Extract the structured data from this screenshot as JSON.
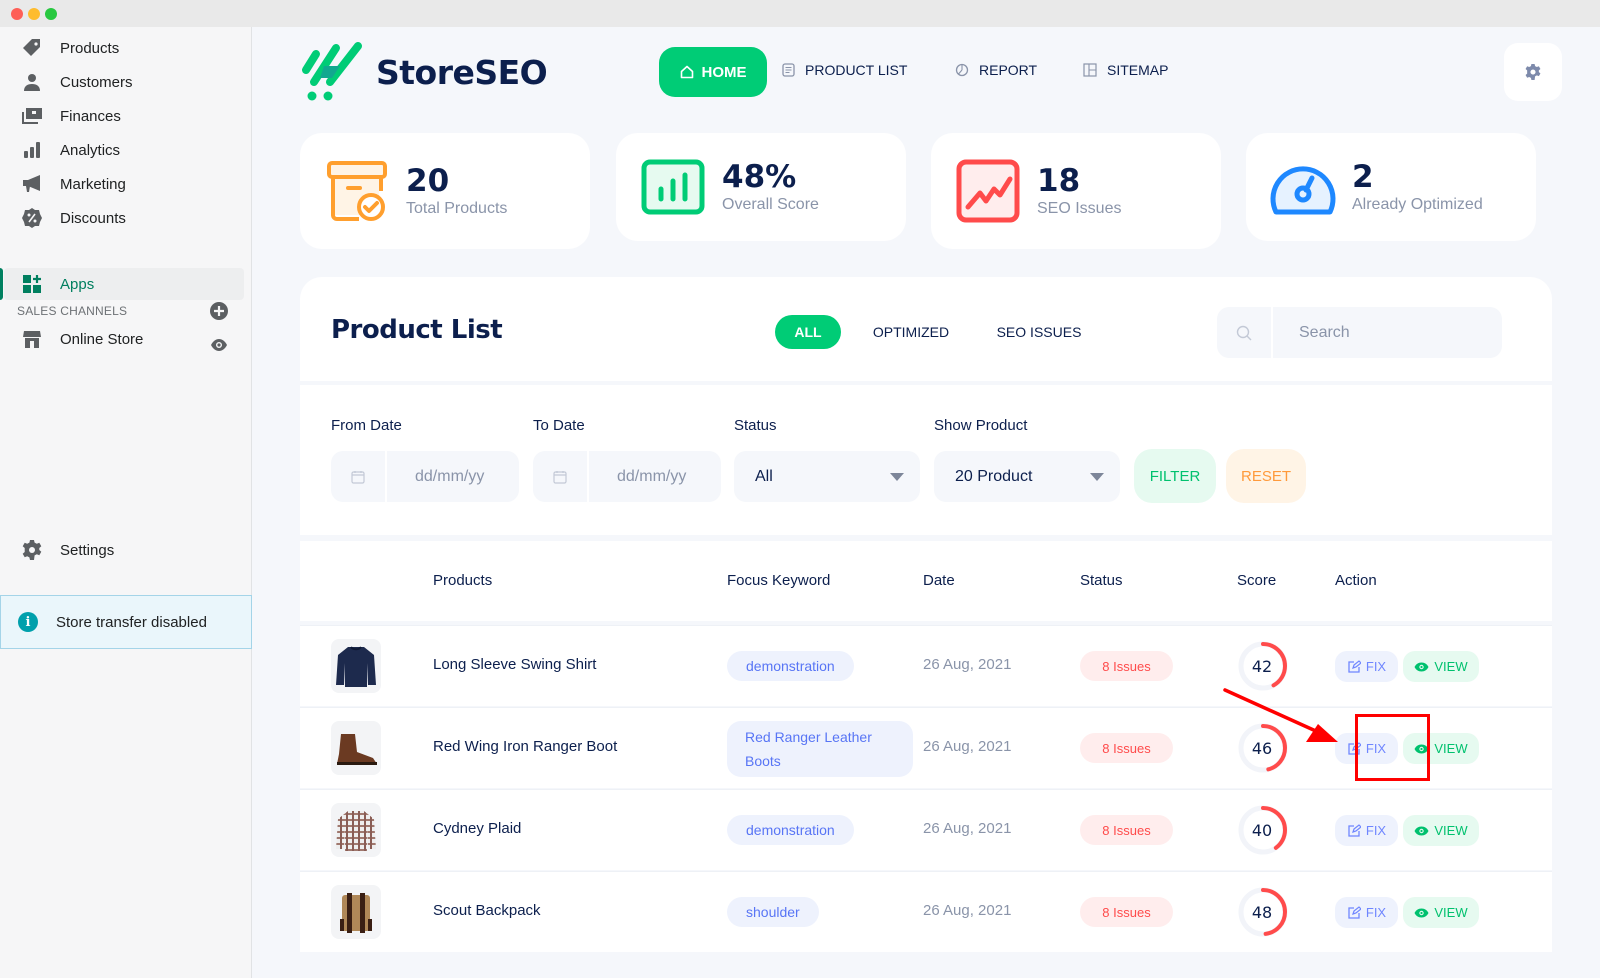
{
  "window": {
    "controls": [
      "close",
      "minimize",
      "maximize"
    ]
  },
  "sidebar": {
    "items": [
      {
        "label": "Products",
        "icon": "tag-icon"
      },
      {
        "label": "Customers",
        "icon": "person-icon"
      },
      {
        "label": "Finances",
        "icon": "finances-icon"
      },
      {
        "label": "Analytics",
        "icon": "bar-chart-icon"
      },
      {
        "label": "Marketing",
        "icon": "megaphone-icon"
      },
      {
        "label": "Discounts",
        "icon": "discount-icon"
      },
      {
        "label": "Apps",
        "icon": "apps-icon",
        "active": true
      }
    ],
    "sales_channels_label": "SALES CHANNELS",
    "online_store_label": "Online Store",
    "settings_label": "Settings",
    "transfer_notice": "Store transfer disabled",
    "info_glyph": "i"
  },
  "header": {
    "app_name": "StoreSEO",
    "nav": [
      {
        "label": "HOME",
        "icon": "home-icon",
        "active": true
      },
      {
        "label": "PRODUCT LIST",
        "icon": "list-icon"
      },
      {
        "label": "REPORT",
        "icon": "report-icon"
      },
      {
        "label": "SITEMAP",
        "icon": "sitemap-icon"
      }
    ]
  },
  "stats": [
    {
      "value": "20",
      "label": "Total Products",
      "color": "#ff9f2e"
    },
    {
      "value": "48%",
      "label": "Overall Score",
      "color": "#00cc76"
    },
    {
      "value": "18",
      "label": "SEO Issues",
      "color": "#ff4b4b"
    },
    {
      "value": "2",
      "label": "Already Optimized",
      "color": "#1e88ff"
    }
  ],
  "product_list": {
    "title": "Product List",
    "tabs": [
      {
        "label": "ALL",
        "active": true
      },
      {
        "label": "OPTIMIZED"
      },
      {
        "label": "SEO ISSUES"
      }
    ],
    "search_placeholder": "Search",
    "filters": {
      "from_date_label": "From Date",
      "from_date_placeholder": "dd/mm/yy",
      "to_date_label": "To Date",
      "to_date_placeholder": "dd/mm/yy",
      "status_label": "Status",
      "status_value": "All",
      "show_label": "Show Product",
      "show_value": "20 Product",
      "filter_button": "FILTER",
      "reset_button": "RESET"
    },
    "columns": [
      "Products",
      "Focus Keyword",
      "Date",
      "Status",
      "Score",
      "Action"
    ],
    "rows": [
      {
        "name": "Long Sleeve Swing Shirt",
        "keyword": "demonstration",
        "date": "26 Aug, 2021",
        "status": "8 Issues",
        "score": "42",
        "score_value": 42,
        "fix": "FIX",
        "view": "VIEW",
        "thumb": "shirt"
      },
      {
        "name": "Red Wing Iron Ranger Boot",
        "keyword_line1": "Red Ranger Leather",
        "keyword_line2": "Boots",
        "date": "26 Aug, 2021",
        "status": "8 Issues",
        "score": "46",
        "score_value": 46,
        "fix": "FIX",
        "view": "VIEW",
        "thumb": "boot"
      },
      {
        "name": "Cydney Plaid",
        "keyword": "demonstration",
        "date": "26 Aug, 2021",
        "status": "8 Issues",
        "score": "40",
        "score_value": 40,
        "fix": "FIX",
        "view": "VIEW",
        "thumb": "plaid"
      },
      {
        "name": "Scout Backpack",
        "keyword": "shoulder",
        "date": "26 Aug, 2021",
        "status": "8 Issues",
        "score": "48",
        "score_value": 48,
        "fix": "FIX",
        "view": "VIEW",
        "thumb": "backpack"
      }
    ]
  },
  "colors": {
    "accent_green": "#00cc76",
    "navy": "#0c1f4d",
    "issue_red": "#ff4b4b",
    "fix_blue": "#6f86ff",
    "annotation_red": "#ff0000"
  }
}
